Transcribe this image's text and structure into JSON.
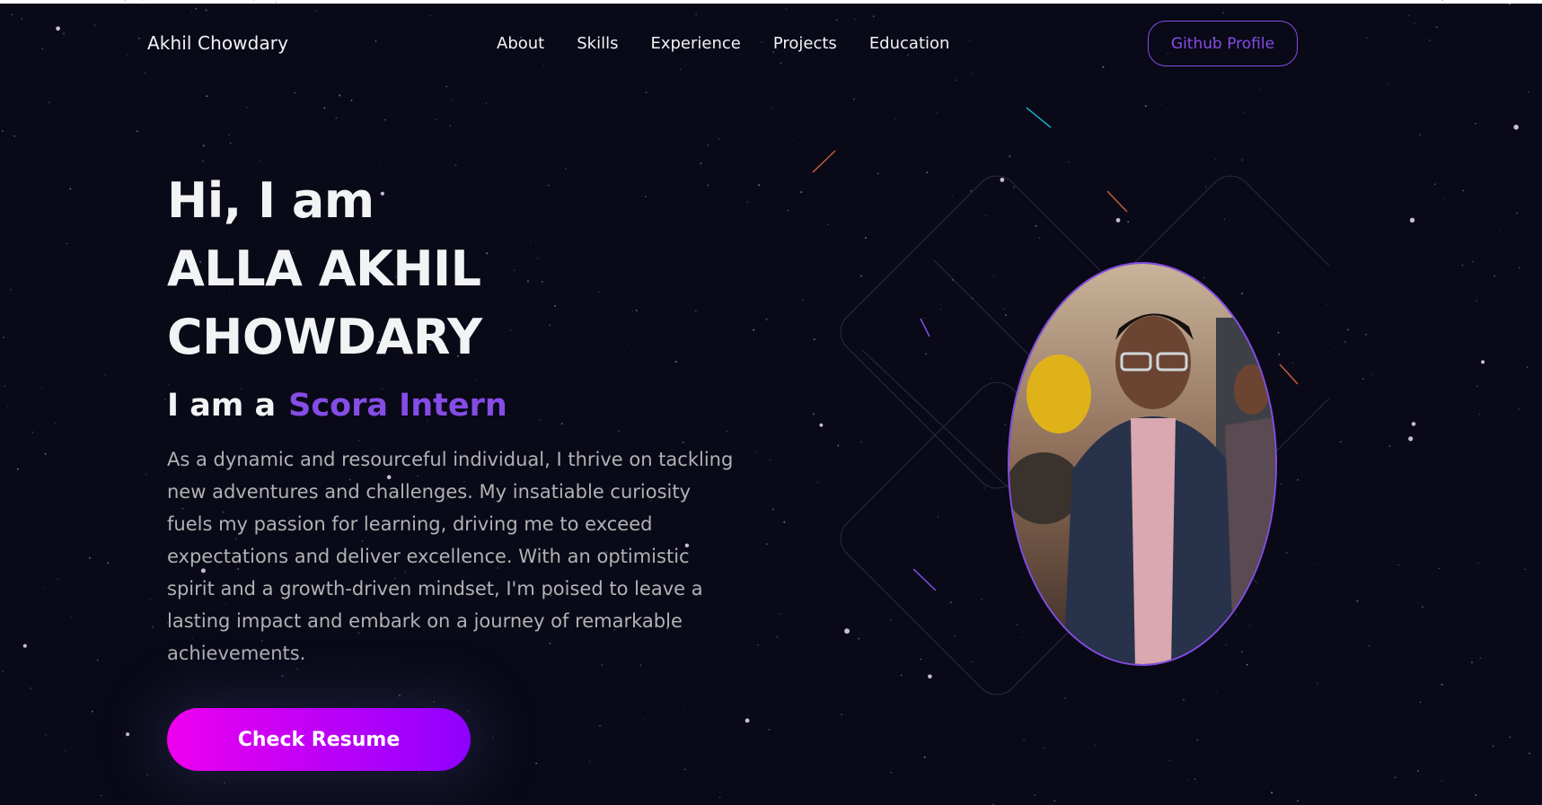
{
  "nav": {
    "brand": "Akhil Chowdary",
    "links": [
      "About",
      "Skills",
      "Experience",
      "Projects",
      "Education"
    ],
    "github_label": "Github Profile"
  },
  "hero": {
    "greeting": "Hi, I am",
    "name_line1": "ALLA AKHIL",
    "name_line2": "CHOWDARY",
    "subtitle_lead": "I am a",
    "subtitle_role": "Scora Intern",
    "description": "As a dynamic and resourceful individual, I thrive on tackling new adventures and challenges. My insatiable curiosity fuels my passion for learning, driving me to exceed expectations and deliver excellence. With an optimistic spirit and a growth-driven mindset, I'm poised to leave a lasting impact and embark on a journey of remarkable achievements.",
    "resume_label": "Check Resume"
  },
  "colors": {
    "background": "#090917",
    "accent": "#854ce6",
    "text_primary": "#f2f3f4",
    "text_secondary": "#b1b2b3",
    "button_gradient_start": "#ee00ee",
    "button_gradient_end": "#8f00ff"
  },
  "icons": {
    "profile_photo": "profile-photo",
    "starfield": "starfield-background"
  }
}
